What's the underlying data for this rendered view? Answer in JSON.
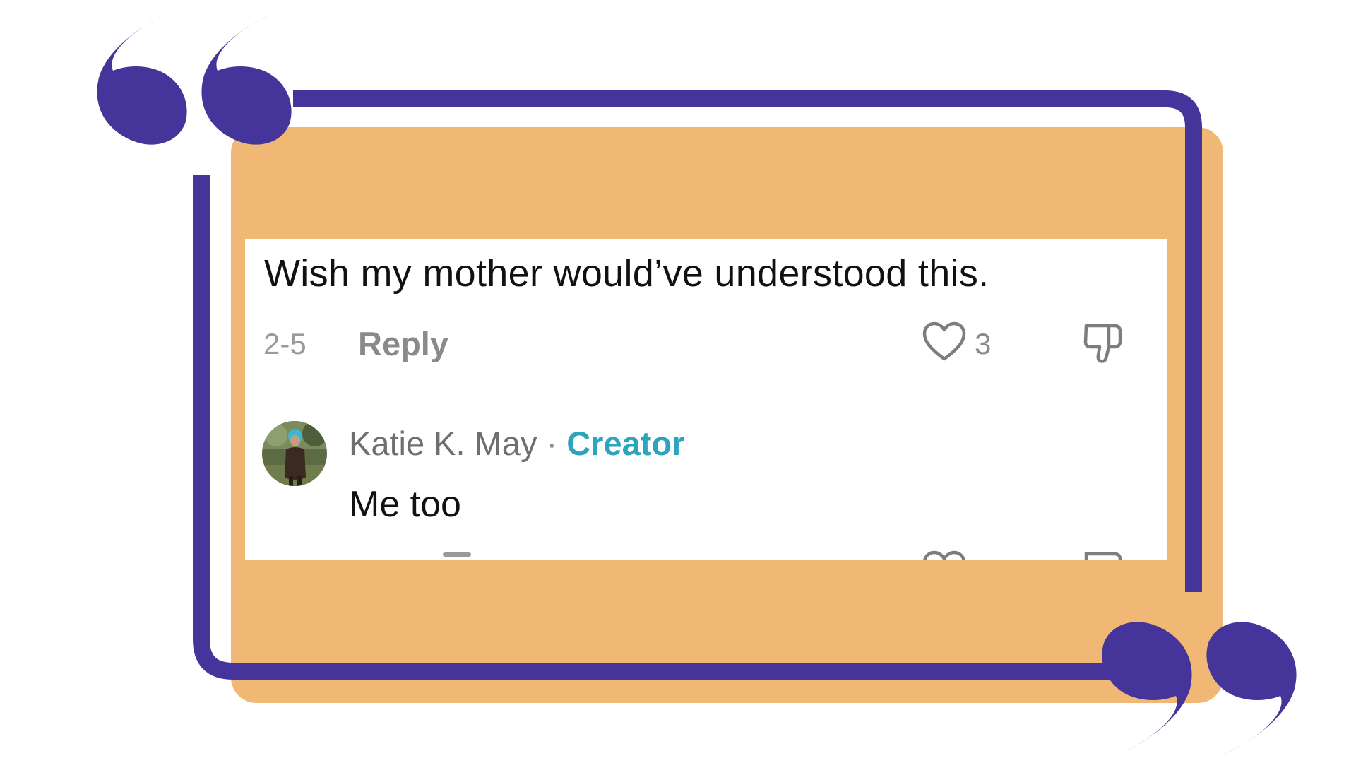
{
  "colors": {
    "accent_purple": "#45359b",
    "card_orange": "#f0b874",
    "creator_teal": "#2aa5bd"
  },
  "comment": {
    "text": "Wish my mother would’ve understood this.",
    "date": "2-5",
    "reply_label": "Reply",
    "like_count": "3",
    "like_icon": "heart-icon",
    "dislike_icon": "thumbs-down-icon"
  },
  "reply_comment": {
    "author": "Katie K. May",
    "separator": "·",
    "badge": "Creator",
    "text": "Me too",
    "avatar_icon": "avatar"
  },
  "decor": {
    "open_quote_icon": "open-quote-icon",
    "close_quote_icon": "close-quote-icon"
  }
}
